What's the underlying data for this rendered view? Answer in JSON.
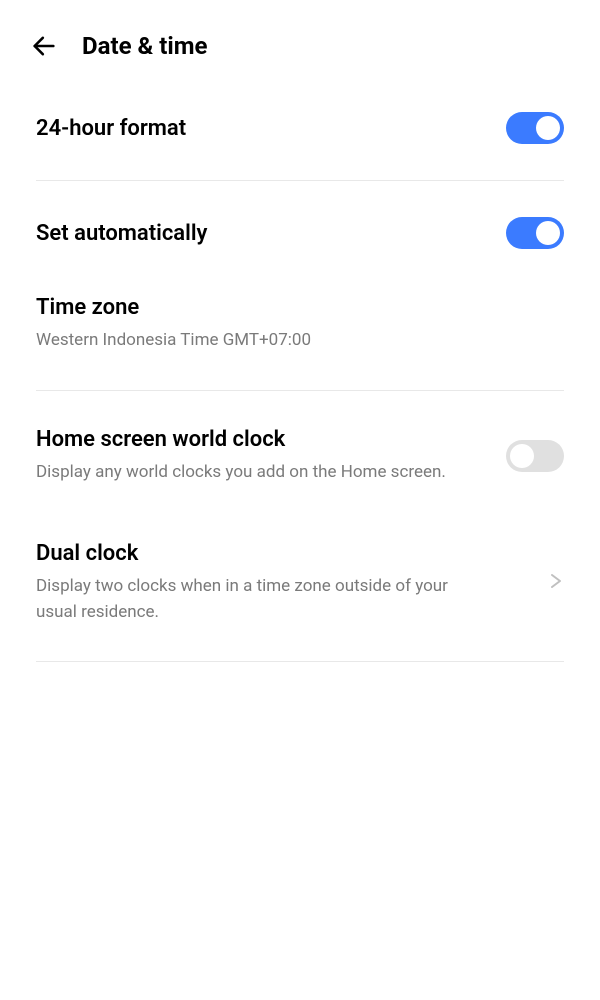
{
  "header": {
    "title": "Date & time"
  },
  "settings": {
    "format24h": {
      "label": "24-hour format",
      "enabled": true
    },
    "setAuto": {
      "label": "Set automatically",
      "enabled": true
    },
    "timezone": {
      "label": "Time zone",
      "value": "Western Indonesia Time GMT+07:00"
    },
    "homeScreenClock": {
      "label": "Home screen world clock",
      "description": "Display any world clocks you add on the Home screen.",
      "enabled": false
    },
    "dualClock": {
      "label": "Dual clock",
      "description": "Display two clocks when in a time zone outside of your usual residence."
    }
  }
}
